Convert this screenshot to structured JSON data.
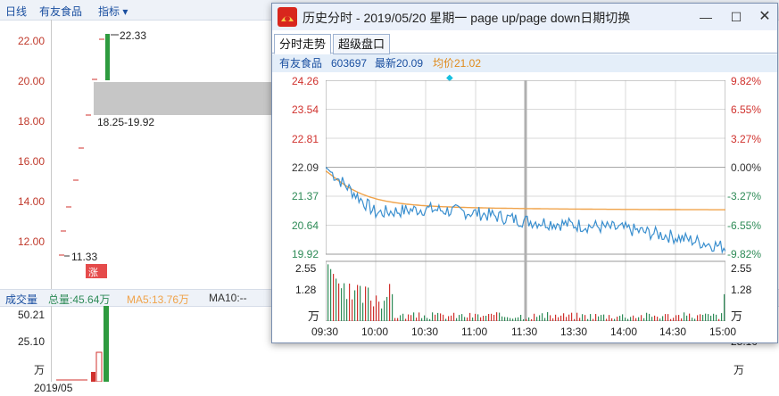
{
  "bg": {
    "top_bar": {
      "daily": "日线",
      "stock": "有友食品",
      "indicator": "指标"
    },
    "price_axis": [
      "22.00",
      "20.00",
      "18.00",
      "16.00",
      "14.00",
      "12.00"
    ],
    "label_high": "22.33",
    "label_low": "11.33",
    "range_label": "18.25-19.92",
    "rise_badge": "涨",
    "volume_bar": {
      "title": "成交量",
      "total": "总量:45.64万",
      "ma5": "MA5:13.76万",
      "ma10": "MA10:--"
    },
    "vol_axis": [
      "50.21",
      "25.10",
      "万"
    ],
    "right_vol_axis": [
      "25.10",
      "万"
    ],
    "date_label": "2019/05"
  },
  "window": {
    "title": "历史分时 - 2019/05/20 星期一 page up/page down日期切换",
    "tabs": [
      "分时走势",
      "超级盘口"
    ],
    "info": {
      "name": "有友食品",
      "code": "603697",
      "latest": "最新20.09",
      "avg": "均价21.02"
    },
    "price_ticks": [
      "24.26",
      "23.54",
      "22.81",
      "22.09",
      "21.37",
      "20.64",
      "19.92"
    ],
    "pct_ticks": [
      "9.82%",
      "6.55%",
      "3.27%",
      "0.00%",
      "-3.27%",
      "-6.55%",
      "-9.82%"
    ],
    "vol_ticks_left": [
      "2.55",
      "1.28",
      "万"
    ],
    "vol_ticks_right": [
      "2.55",
      "1.28",
      "万"
    ],
    "time_ticks": [
      "09:30",
      "10:00",
      "10:30",
      "11:00",
      "11:30",
      "13:30",
      "14:00",
      "14:30",
      "15:00"
    ],
    "colors": {
      "up": "#d0312d",
      "down": "#2e8b57",
      "price_line": "#3a8fcf",
      "avg_line": "#f0a34a"
    }
  },
  "chart_data": {
    "type": "line",
    "title": "",
    "x": [
      "09:30",
      "10:00",
      "10:30",
      "11:00",
      "11:30",
      "13:30",
      "14:00",
      "14:30",
      "15:00"
    ],
    "series": [
      {
        "values": [
          22.09,
          20.95,
          21.05,
          20.95,
          20.75,
          20.65,
          20.55,
          20.35,
          20.09
        ]
      },
      {
        "values": [
          22.0,
          21.3,
          21.18,
          21.12,
          21.09,
          21.06,
          21.05,
          21.03,
          21.02
        ]
      }
    ],
    "ylim": [
      19.92,
      24.26
    ],
    "volume_ylim": [
      0,
      2.55
    ]
  }
}
